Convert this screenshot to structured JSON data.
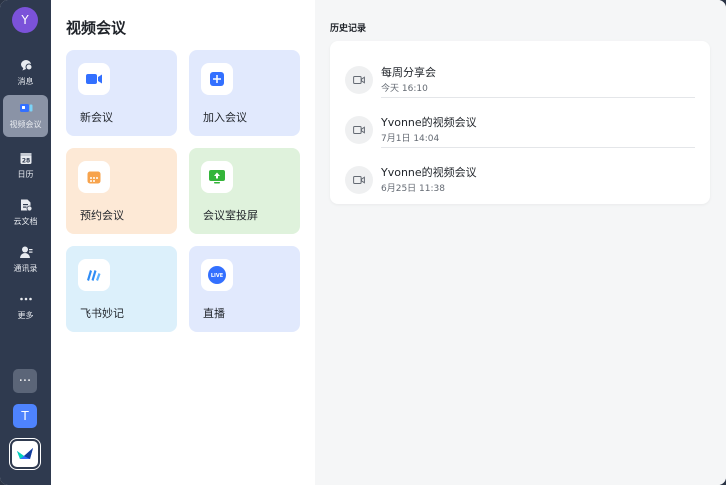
{
  "sidebar": {
    "user_initial": "Y",
    "items": [
      {
        "label": "消息",
        "icon": "chat-bubble-icon"
      },
      {
        "label": "视频会议",
        "icon": "video-meeting-icon"
      },
      {
        "label": "日历",
        "icon": "calendar-icon",
        "day": "28"
      },
      {
        "label": "云文档",
        "icon": "cloud-doc-icon"
      },
      {
        "label": "通讯录",
        "icon": "contacts-icon"
      },
      {
        "label": "更多",
        "icon": "more-dots-icon"
      }
    ],
    "more_apps_glyph": "···",
    "workspace_initial": "T"
  },
  "main": {
    "title": "视频会议",
    "cards": [
      {
        "label": "新会议",
        "icon": "video-camera-icon",
        "bg": "#e1e9fd",
        "icon_color": "#3370ff"
      },
      {
        "label": "加入会议",
        "icon": "plus-square-icon",
        "bg": "#e1e9fd",
        "icon_color": "#3370ff"
      },
      {
        "label": "预约会议",
        "icon": "calendar-schedule-icon",
        "bg": "#fde9d6",
        "icon_color": "#f7a34c"
      },
      {
        "label": "会议室投屏",
        "icon": "screen-share-icon",
        "bg": "#dff2dc",
        "icon_color": "#34b53a"
      },
      {
        "label": "飞书妙记",
        "icon": "minutes-icon",
        "bg": "#dcf0fb",
        "icon_color": "#2f8cf5"
      },
      {
        "label": "直播",
        "icon": "live-icon",
        "bg": "#e1e9fd",
        "icon_color": "#3370ff",
        "badge": "LIVE"
      }
    ]
  },
  "history": {
    "title": "历史记录",
    "items": [
      {
        "name": "每周分享会",
        "time": "今天 16:10"
      },
      {
        "name": "Yvonne的视频会议",
        "time": "7月1日 14:04"
      },
      {
        "name": "Yvonne的视频会议",
        "time": "6月25日 11:38"
      }
    ]
  },
  "colors": {
    "sidebar_bg": "#2f3a4f",
    "accent": "#3370ff",
    "avatar": "#7b52d9"
  }
}
